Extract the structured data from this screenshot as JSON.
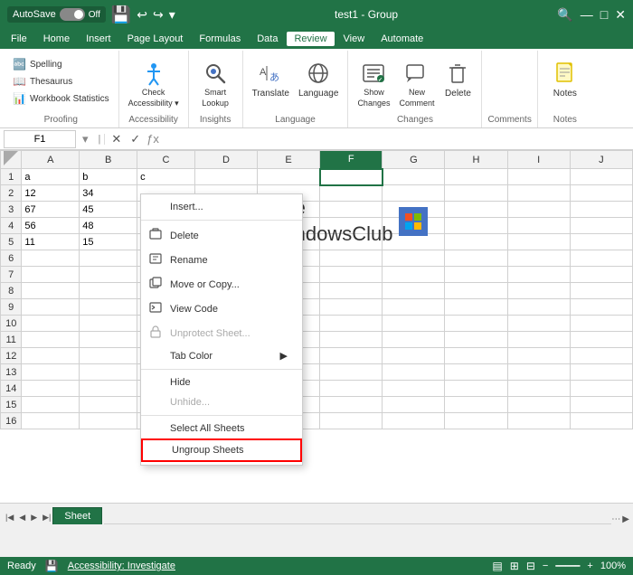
{
  "titleBar": {
    "autoSave": "AutoSave",
    "autoSaveState": "Off",
    "title": "test1 - Group",
    "searchPlaceholder": "🔍"
  },
  "menuBar": {
    "items": [
      "File",
      "Home",
      "Insert",
      "Page Layout",
      "Formulas",
      "Data",
      "Review",
      "View",
      "Automate"
    ]
  },
  "ribbon": {
    "groups": [
      {
        "label": "Proofing",
        "items": [
          {
            "label": "Spelling",
            "icon": "🔤",
            "small": true
          },
          {
            "label": "Thesaurus",
            "icon": "📖",
            "small": true
          },
          {
            "label": "Workbook Statistics",
            "icon": "📊",
            "small": true
          }
        ]
      },
      {
        "label": "Accessibility",
        "items": [
          {
            "label": "Check Accessibility ▾",
            "icon": "♿",
            "big": true
          }
        ]
      },
      {
        "label": "Insights",
        "items": [
          {
            "label": "Smart Lookup",
            "icon": "🔍",
            "big": true
          }
        ]
      },
      {
        "label": "Language",
        "items": [
          {
            "label": "Translate",
            "icon": "🌐",
            "big": true
          },
          {
            "label": "Language",
            "icon": "📝",
            "big": true
          }
        ]
      },
      {
        "label": "Changes",
        "items": [
          {
            "label": "Show Changes",
            "icon": "📋",
            "big": true
          },
          {
            "label": "New Comment",
            "icon": "💬",
            "big": true
          },
          {
            "label": "Delete",
            "icon": "🗑",
            "big": true
          }
        ]
      },
      {
        "label": "Comments",
        "items": []
      },
      {
        "label": "Notes",
        "items": [
          {
            "label": "Notes",
            "icon": "📌",
            "big": true
          }
        ]
      }
    ]
  },
  "formulaBar": {
    "nameBox": "F1",
    "formula": ""
  },
  "grid": {
    "colHeaders": [
      "",
      "A",
      "B",
      "C",
      "D",
      "E",
      "F",
      "G",
      "H",
      "I",
      "J"
    ],
    "rows": [
      [
        "1",
        "a",
        "b",
        "c",
        "",
        "",
        "",
        "",
        "",
        "",
        ""
      ],
      [
        "2",
        "12",
        "34",
        "",
        "",
        "",
        "",
        "",
        "",
        "",
        ""
      ],
      [
        "3",
        "67",
        "45",
        "",
        "",
        "",
        "",
        "",
        "",
        "",
        ""
      ],
      [
        "4",
        "56",
        "48",
        "",
        "",
        "",
        "",
        "",
        "",
        "",
        ""
      ],
      [
        "5",
        "11",
        "15",
        "",
        "",
        "",
        "",
        "",
        "",
        "",
        ""
      ],
      [
        "6",
        "",
        "",
        "",
        "",
        "",
        "",
        "",
        "",
        "",
        ""
      ],
      [
        "7",
        "",
        "",
        "",
        "",
        "",
        "",
        "",
        "",
        "",
        ""
      ],
      [
        "8",
        "",
        "",
        "",
        "",
        "",
        "",
        "",
        "",
        "",
        ""
      ],
      [
        "9",
        "",
        "",
        "",
        "",
        "",
        "",
        "",
        "",
        "",
        ""
      ],
      [
        "10",
        "",
        "",
        "",
        "",
        "",
        "",
        "",
        "",
        "",
        ""
      ],
      [
        "11",
        "",
        "",
        "",
        "",
        "",
        "",
        "",
        "",
        "",
        ""
      ],
      [
        "12",
        "",
        "",
        "",
        "",
        "",
        "",
        "",
        "",
        "",
        ""
      ],
      [
        "13",
        "",
        "",
        "",
        "",
        "",
        "",
        "",
        "",
        "",
        ""
      ],
      [
        "14",
        "",
        "",
        "",
        "",
        "",
        "",
        "",
        "",
        "",
        ""
      ],
      [
        "15",
        "",
        "",
        "",
        "",
        "",
        "",
        "",
        "",
        "",
        ""
      ],
      [
        "16",
        "",
        "",
        "",
        "",
        "",
        "",
        "",
        "",
        "",
        ""
      ]
    ]
  },
  "watermark": {
    "line1": "The",
    "line2": "WindowsClub"
  },
  "contextMenu": {
    "items": [
      {
        "label": "Insert...",
        "icon": "",
        "hasIcon": false
      },
      {
        "label": "Delete",
        "icon": "",
        "hasIcon": true
      },
      {
        "label": "Rename",
        "icon": "",
        "hasIcon": true
      },
      {
        "label": "Move or Copy...",
        "icon": "",
        "hasIcon": true
      },
      {
        "label": "View Code",
        "icon": "",
        "hasIcon": true
      },
      {
        "label": "Unprotect Sheet...",
        "icon": "",
        "hasIcon": true,
        "disabled": true
      },
      {
        "label": "Tab Color",
        "icon": "",
        "hasIcon": false,
        "hasSubmenu": true
      },
      {
        "label": "Hide",
        "icon": "",
        "hasIcon": false
      },
      {
        "label": "Unhide...",
        "icon": "",
        "hasIcon": false,
        "disabled": true
      },
      {
        "label": "Select All Sheets",
        "icon": "",
        "hasIcon": false
      },
      {
        "label": "Ungroup Sheets",
        "icon": "",
        "hasIcon": false,
        "highlighted": true
      }
    ]
  },
  "sheetTabs": {
    "sheets": [
      "Sheet"
    ]
  },
  "statusBar": {
    "ready": "Ready",
    "accessibility": "Accessibility: Investigate"
  }
}
